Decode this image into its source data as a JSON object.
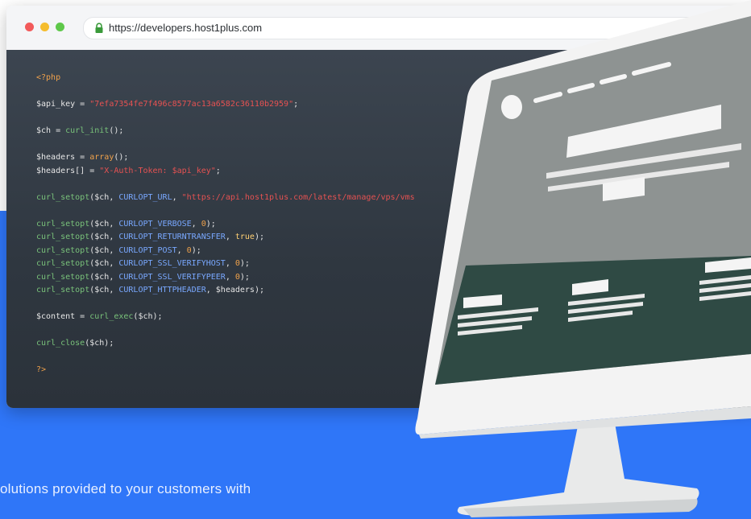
{
  "browser": {
    "url": "https://developers.host1plus.com"
  },
  "code_lines": [
    "<?php",
    "",
    "$api_key = \"7efa7354fe7f496c8577ac13a6582c36110b2959\";",
    "",
    "$ch = curl_init();",
    "",
    "$headers = array();",
    "$headers[] = \"X-Auth-Token: $api_key\";",
    "",
    "curl_setopt($ch, CURLOPT_URL, \"https://api.host1plus.com/latest/manage/vps/vms",
    "",
    "curl_setopt($ch, CURLOPT_VERBOSE, 0);",
    "curl_setopt($ch, CURLOPT_RETURNTRANSFER, true);",
    "curl_setopt($ch, CURLOPT_POST, 0);",
    "curl_setopt($ch, CURLOPT_SSL_VERIFYHOST, 0);",
    "curl_setopt($ch, CURLOPT_SSL_VERIFYPEER, 0);",
    "curl_setopt($ch, CURLOPT_HTTPHEADER, $headers);",
    "",
    "$content = curl_exec($ch);",
    "",
    "curl_close($ch);",
    "",
    "?>"
  ],
  "tagline": "olutions provided to your customers with",
  "colors": {
    "blue_band": "#2f76f8",
    "code_background": "#353d46",
    "monitor_screen": "#8e9392",
    "monitor_bezel": "#f2f2f2"
  },
  "icons": {
    "lock": "padlock",
    "window_controls": [
      "red-dot",
      "yellow-dot",
      "green-dot"
    ]
  }
}
